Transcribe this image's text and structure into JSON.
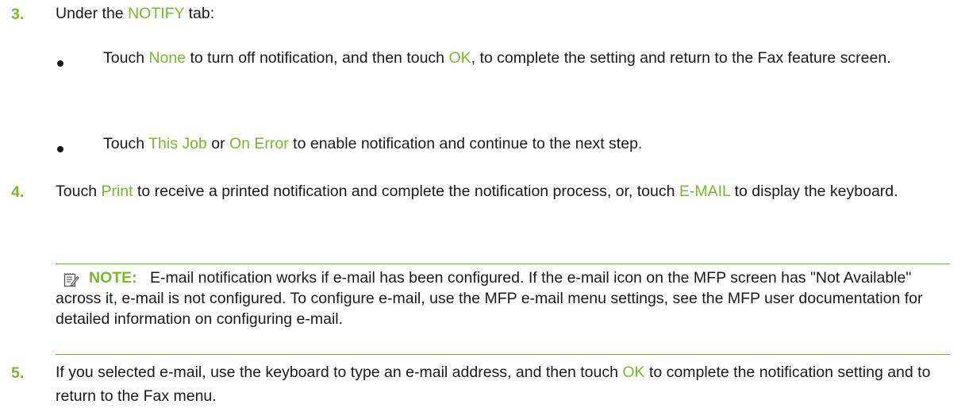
{
  "step3": {
    "number": "3.",
    "pre": "Under the ",
    "tab": "NOTIFY",
    "post": " tab:",
    "bullets": [
      {
        "pre": "Touch ",
        "h1": "None",
        "mid": " to turn off notification, and then touch ",
        "h2": "OK",
        "post": ", to complete the setting and return to the Fax feature screen."
      },
      {
        "pre": "Touch ",
        "h1": "This Job",
        "mid": " or ",
        "h2": "On Error",
        "post": " to enable notification and continue to the next step."
      }
    ]
  },
  "step4": {
    "number": "4.",
    "pre": "Touch ",
    "h1": "Print",
    "mid": " to receive a printed notification and complete the notification process, or, touch ",
    "h2": "E-MAIL",
    "post": " to display the keyboard."
  },
  "note": {
    "icon": "note-icon",
    "label": "NOTE:",
    "text": "E-mail notification works if e-mail has been configured. If the e-mail icon on the MFP screen has \"Not Available\" across it, e-mail is not configured. To configure e-mail, use the MFP e-mail menu settings, see the MFP user documentation for detailed information on configuring e-mail."
  },
  "step5": {
    "number": "5.",
    "pre": "If you selected e-mail, use the keyboard to type an e-mail address, and then touch ",
    "h1": "OK",
    "post": " to complete the notification setting and to return to the Fax menu."
  },
  "colors": {
    "accent": "#7ab829",
    "text": "#1a1a1a"
  }
}
